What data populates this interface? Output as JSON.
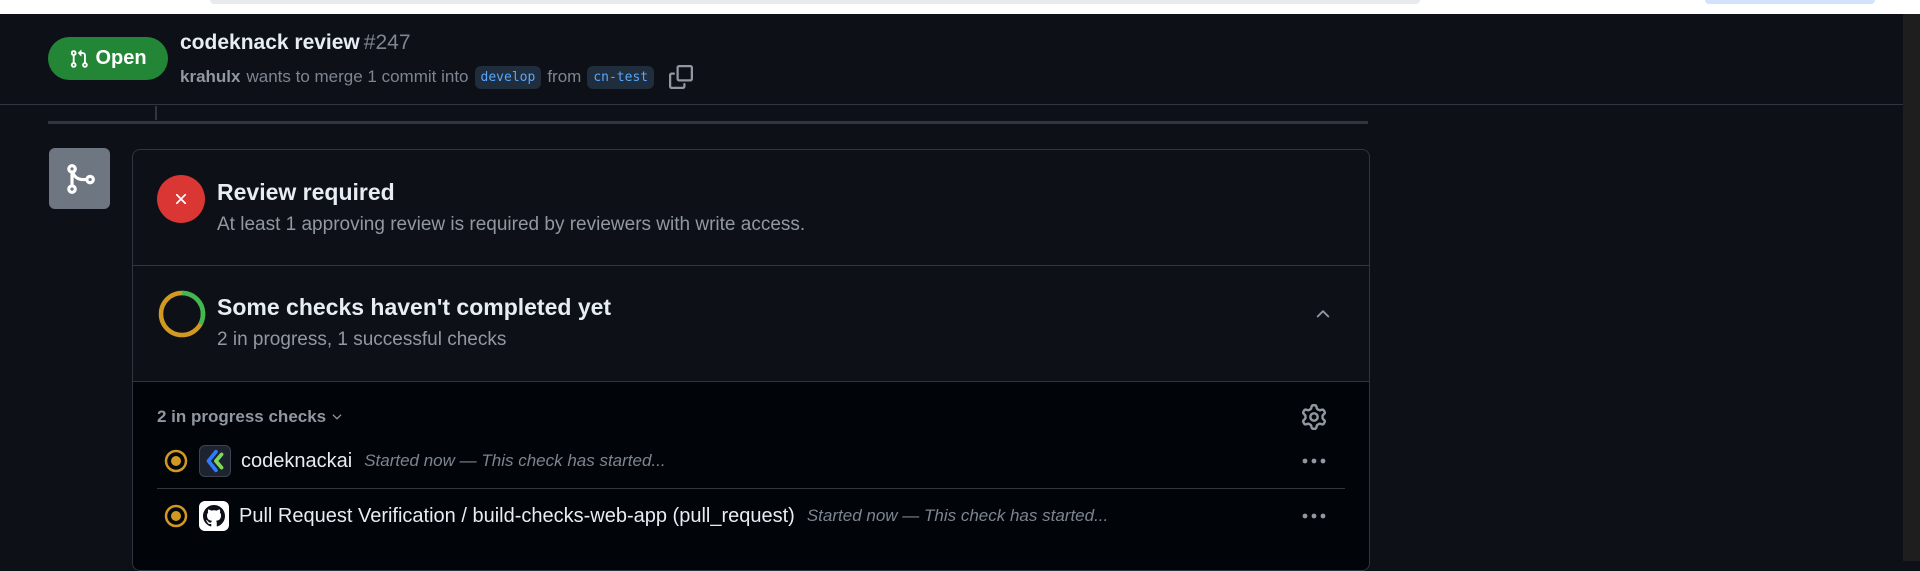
{
  "pr": {
    "state_label": "Open",
    "title": "codeknack review",
    "number": "#247",
    "author": "krahulx",
    "merge_text": "wants to merge 1 commit into",
    "base_branch": "develop",
    "from_text": "from",
    "head_branch": "cn-test"
  },
  "merge_box": {
    "review": {
      "title": "Review required",
      "subtitle": "At least 1 approving review is required by reviewers with write access."
    },
    "checks": {
      "title": "Some checks haven't completed yet",
      "subtitle": "2 in progress, 1 successful checks",
      "progress_fraction_complete": 0.33
    },
    "check_list": {
      "header": "2 in progress checks",
      "rows": [
        {
          "name": "codeknackai",
          "description": "Started now — This check has started...",
          "avatar_icon": "codeknack-logo-icon"
        },
        {
          "name": "Pull Request Verification / build-checks-web-app (pull_request)",
          "description": "Started now — This check has started...",
          "avatar_icon": "github-logo-icon"
        }
      ]
    }
  },
  "colors": {
    "open_green": "#238636",
    "fail_red": "#da3633",
    "pending_yellow": "#d29922",
    "success_green": "#3fb950",
    "branch_blue": "#58a6ff"
  }
}
